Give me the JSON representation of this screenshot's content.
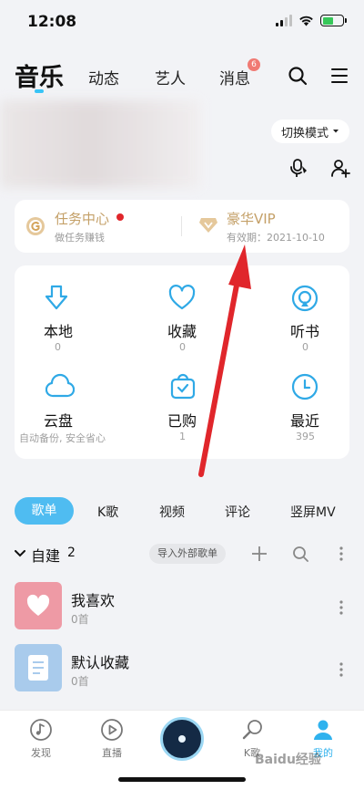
{
  "status": {
    "time": "12:08"
  },
  "top_tabs": [
    {
      "label": "音乐"
    },
    {
      "label": "动态"
    },
    {
      "label": "艺人"
    },
    {
      "label": "消息",
      "badge": "6"
    }
  ],
  "header": {
    "mode_button": "切换模式"
  },
  "task_card": {
    "task_title": "任务中心",
    "task_sub": "做任务赚钱",
    "vip_title": "豪华VIP",
    "vip_sub": "有效期：2021-10-10"
  },
  "grid": [
    {
      "label": "本地",
      "count": "0",
      "icon": "download-icon"
    },
    {
      "label": "收藏",
      "count": "0",
      "icon": "heart-icon"
    },
    {
      "label": "听书",
      "count": "0",
      "icon": "audiobook-icon"
    },
    {
      "label": "云盘",
      "count": "自动备份, 安全省心",
      "icon": "cloud-icon"
    },
    {
      "label": "已购",
      "count": "1",
      "icon": "purchased-bag-icon"
    },
    {
      "label": "最近",
      "count": "395",
      "icon": "clock-icon"
    }
  ],
  "content_tabs": [
    {
      "label": "歌单"
    },
    {
      "label": "K歌"
    },
    {
      "label": "视频"
    },
    {
      "label": "评论"
    },
    {
      "label": "竖屏MV"
    }
  ],
  "self_built": {
    "title": "自建",
    "count": "2",
    "import_label": "导入外部歌单"
  },
  "playlists": [
    {
      "name": "我喜欢",
      "count": "0首"
    },
    {
      "name": "默认收藏",
      "count": "0首"
    }
  ],
  "bottom_nav": [
    {
      "label": "发现"
    },
    {
      "label": "直播"
    },
    {
      "label": "K歌"
    },
    {
      "label": "我的"
    }
  ],
  "watermark": "Baidu经验",
  "colors": {
    "accent": "#31c3f7",
    "gold": "#c4a068",
    "arrow": "#e0262b",
    "tab_active_bg": "#4fbcf1"
  }
}
